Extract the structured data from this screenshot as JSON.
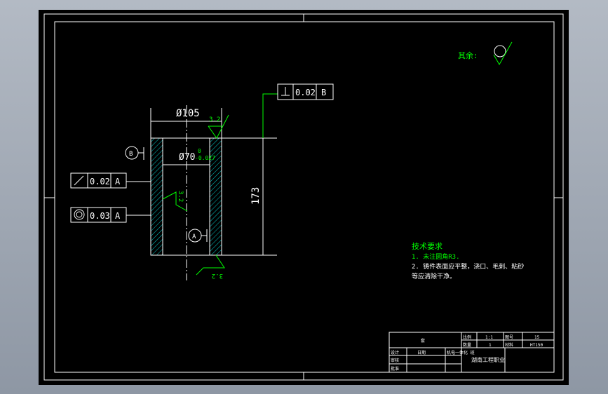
{
  "colors": {
    "line": "#ffffff",
    "annotation": "#00ff00",
    "hatch": "#00c8c8",
    "background": "#000000"
  },
  "roughness_other": "其余:",
  "dims": {
    "outer_dia": "Ø105",
    "inner_dia": "Ø70",
    "tol_upper": "0",
    "tol_lower": "-0.027",
    "height": "173"
  },
  "roughness": {
    "top": "3.2",
    "inner": "3.2",
    "bottom": "3.2"
  },
  "datums": {
    "a": "A",
    "b": "B"
  },
  "fcf": [
    {
      "symbol": "perpendicularity",
      "value": "0.02",
      "datum": "B"
    },
    {
      "symbol": "circular-runout",
      "value": "0.02",
      "datum": "A"
    },
    {
      "symbol": "concentricity",
      "value": "0.03",
      "datum": "A"
    }
  ],
  "tech": {
    "title": "技术要求",
    "line1": "1. 未注圆角R3.",
    "line2": "2. 铸件表面应平整，浇口、毛刺、粘砂",
    "line3": "等应清除干净。"
  },
  "title_block": {
    "name": "套",
    "ratio_label": "比例",
    "ratio": "1:1",
    "count_label": "数量",
    "count": "1",
    "drawing_no_label": "图号",
    "drawing_no": "15",
    "material_label": "材料",
    "material": "HT150",
    "designer": "设计",
    "checker": "审核",
    "approver": "批准",
    "date": "日期",
    "school": "湖南工程职业",
    "class_info": "机电一体化 班"
  }
}
